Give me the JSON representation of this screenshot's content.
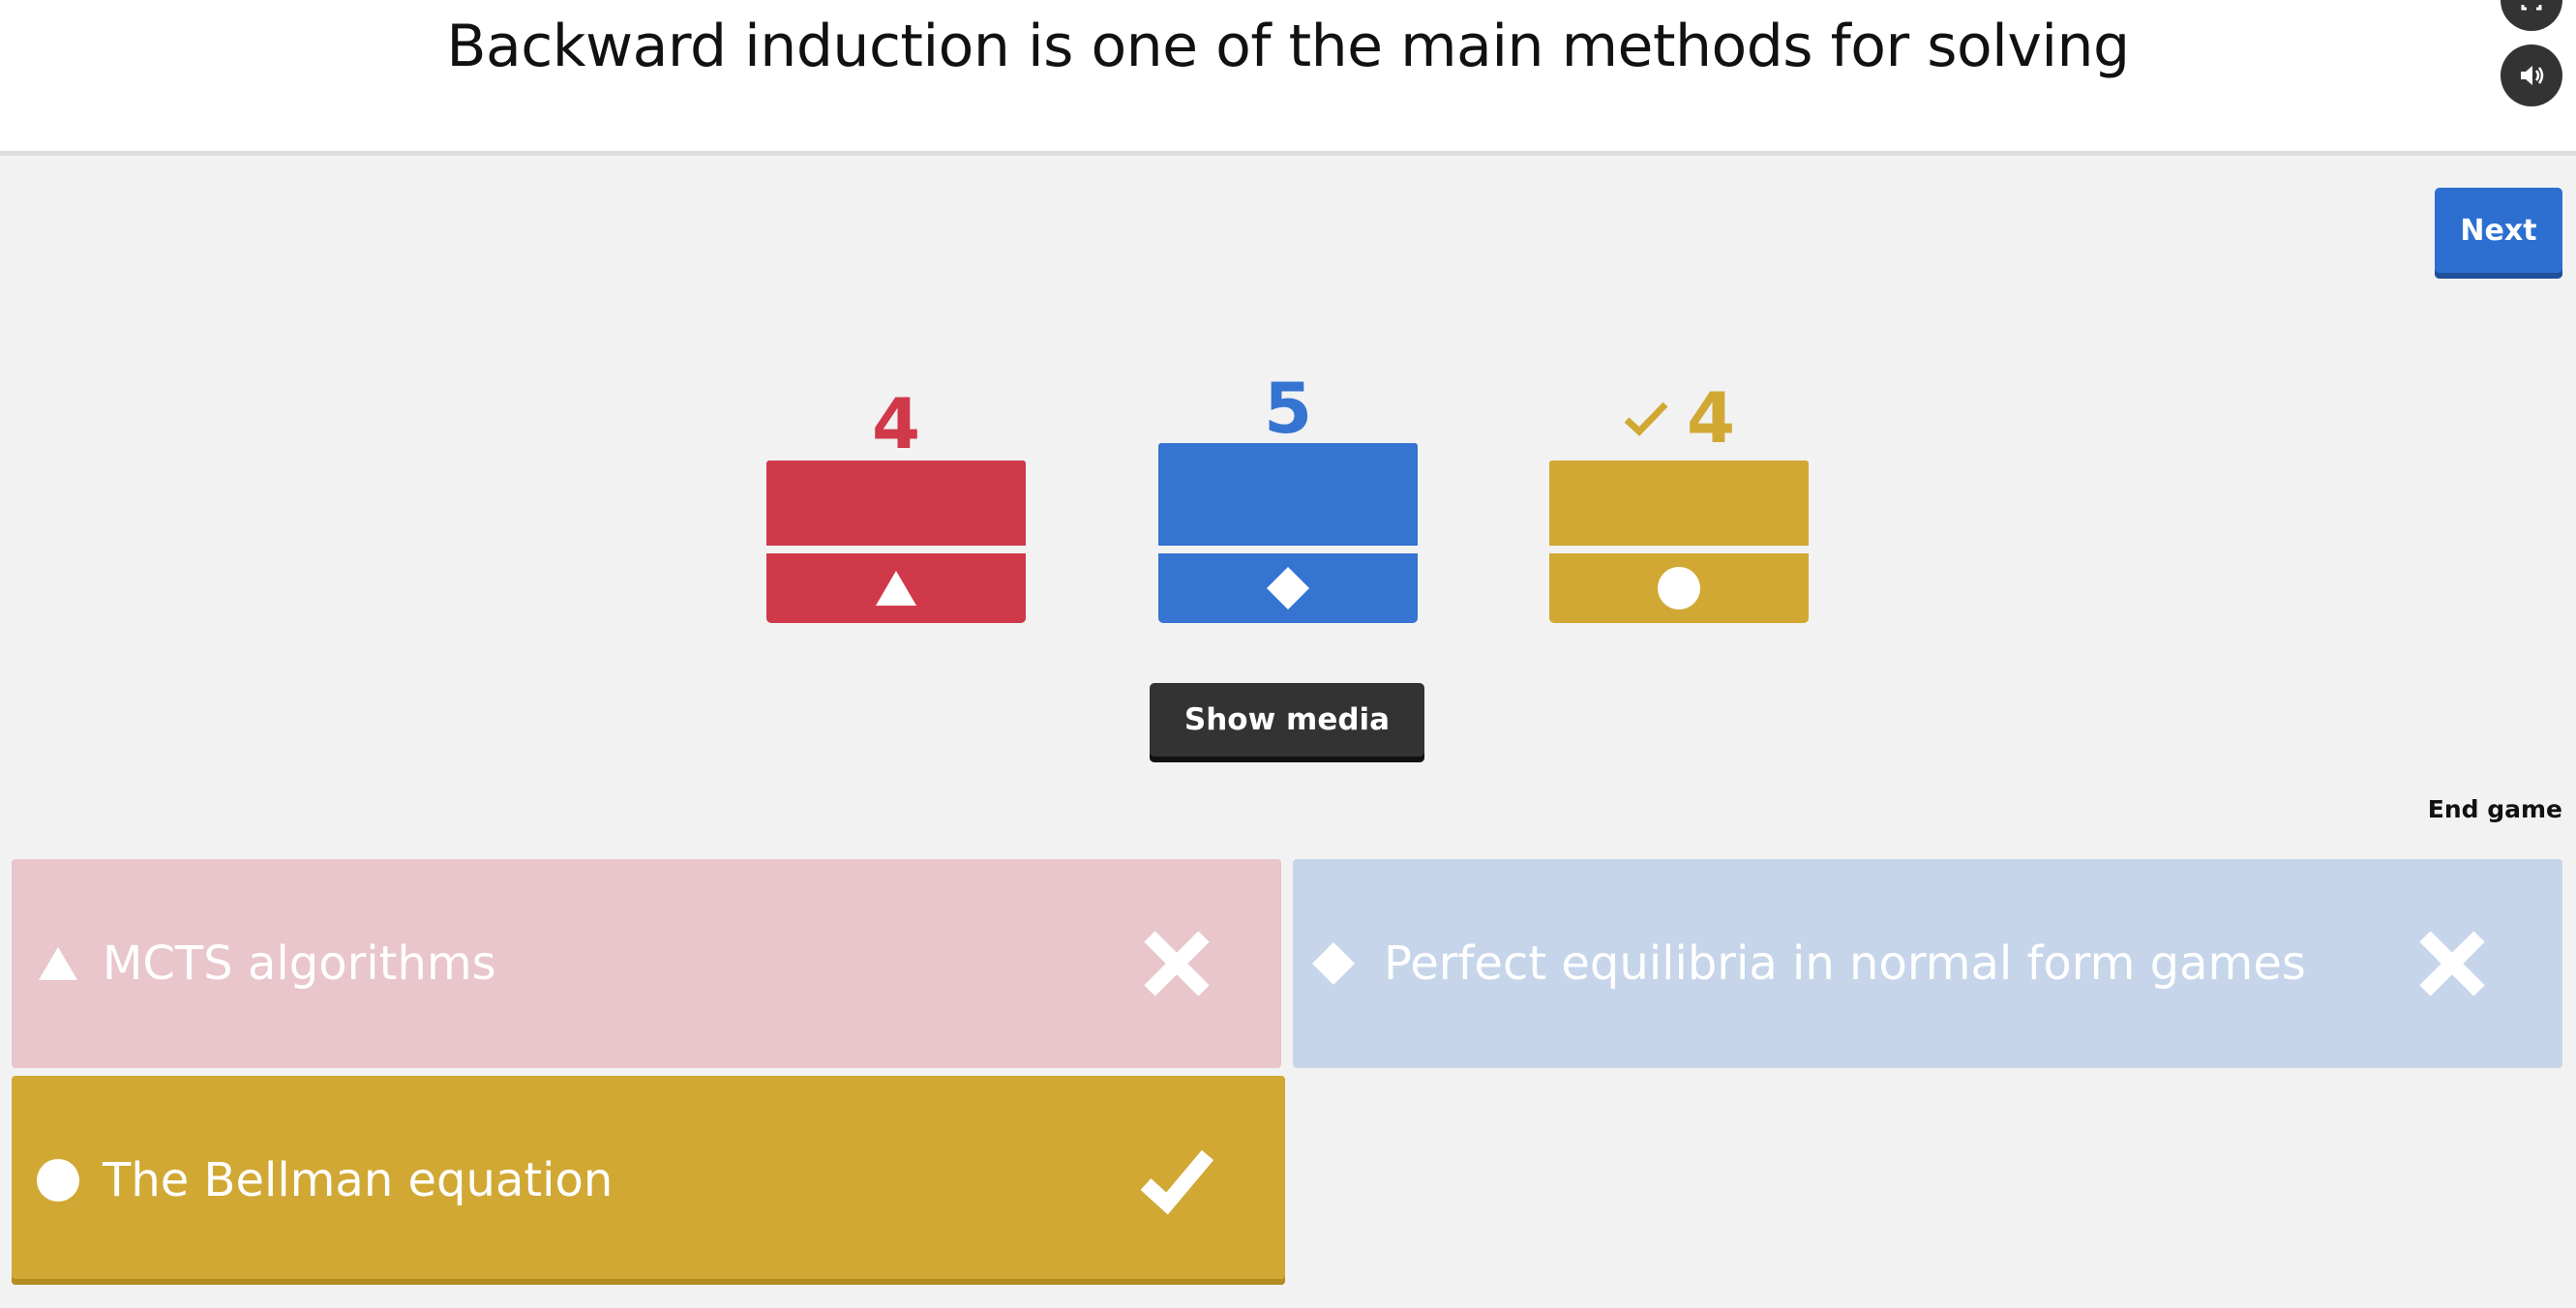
{
  "header": {
    "question": "Backward induction is one of the main methods for solving"
  },
  "controls": {
    "next_label": "Next",
    "show_media_label": "Show media",
    "end_game_label": "End game",
    "fullscreen_icon": "fullscreen-icon",
    "sound_icon": "sound-icon"
  },
  "results": [
    {
      "shape": "triangle",
      "count": "4",
      "correct": false,
      "color": "#d0394a"
    },
    {
      "shape": "diamond",
      "count": "5",
      "correct": false,
      "color": "#3574d0"
    },
    {
      "shape": "circle",
      "count": "4",
      "correct": true,
      "color": "#d1a834"
    }
  ],
  "answers": [
    {
      "shape": "triangle",
      "text": "MCTS algorithms",
      "correct": false
    },
    {
      "shape": "diamond",
      "text": "Perfect equilibria in normal form games",
      "correct": false
    },
    {
      "shape": "circle",
      "text": "The Bellman equation",
      "correct": true
    }
  ]
}
